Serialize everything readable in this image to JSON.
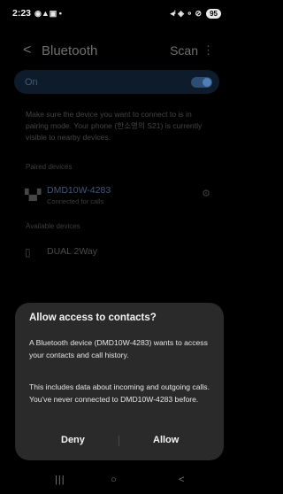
{
  "status_bar": {
    "time": "2:23",
    "left_icons": "◉▲▣ •",
    "right_icons": "◂ᴵ ◈ ⚬ ⊘",
    "battery": "95"
  },
  "app_bar": {
    "back_symbol": "<",
    "title": "Bluetooth",
    "scan_label": "Scan",
    "more_symbol": "⋮"
  },
  "toggle_row": {
    "label": "On",
    "state": "on",
    "accent": "#4f7fb3"
  },
  "description": "Make sure the device you want to connect to is in pairing mode. Your phone (한소영의 S21) is currently visible to nearby devices.",
  "paired": {
    "header": "Paired devices",
    "device_name": "DMD10W-4283",
    "device_status": "Connected for calls",
    "device_icon": "grid-device-icon",
    "settings_icon": "gear-icon"
  },
  "available": {
    "header": "Available devices",
    "device_name": "DUAL 2Way",
    "device_icon": "phone-device-icon"
  },
  "dialog": {
    "title": "Allow access to contacts?",
    "body1": "A Bluetooth device (DMD10W-4283) wants to access your contacts and call history.",
    "body2": "This includes data about incoming and outgoing calls. You've never connected to DMD10W-4283 before.",
    "deny_label": "Deny",
    "allow_label": "Allow"
  },
  "nav_bar": {
    "recent_symbol": "|||",
    "home_symbol": "○",
    "back_symbol": "<"
  }
}
